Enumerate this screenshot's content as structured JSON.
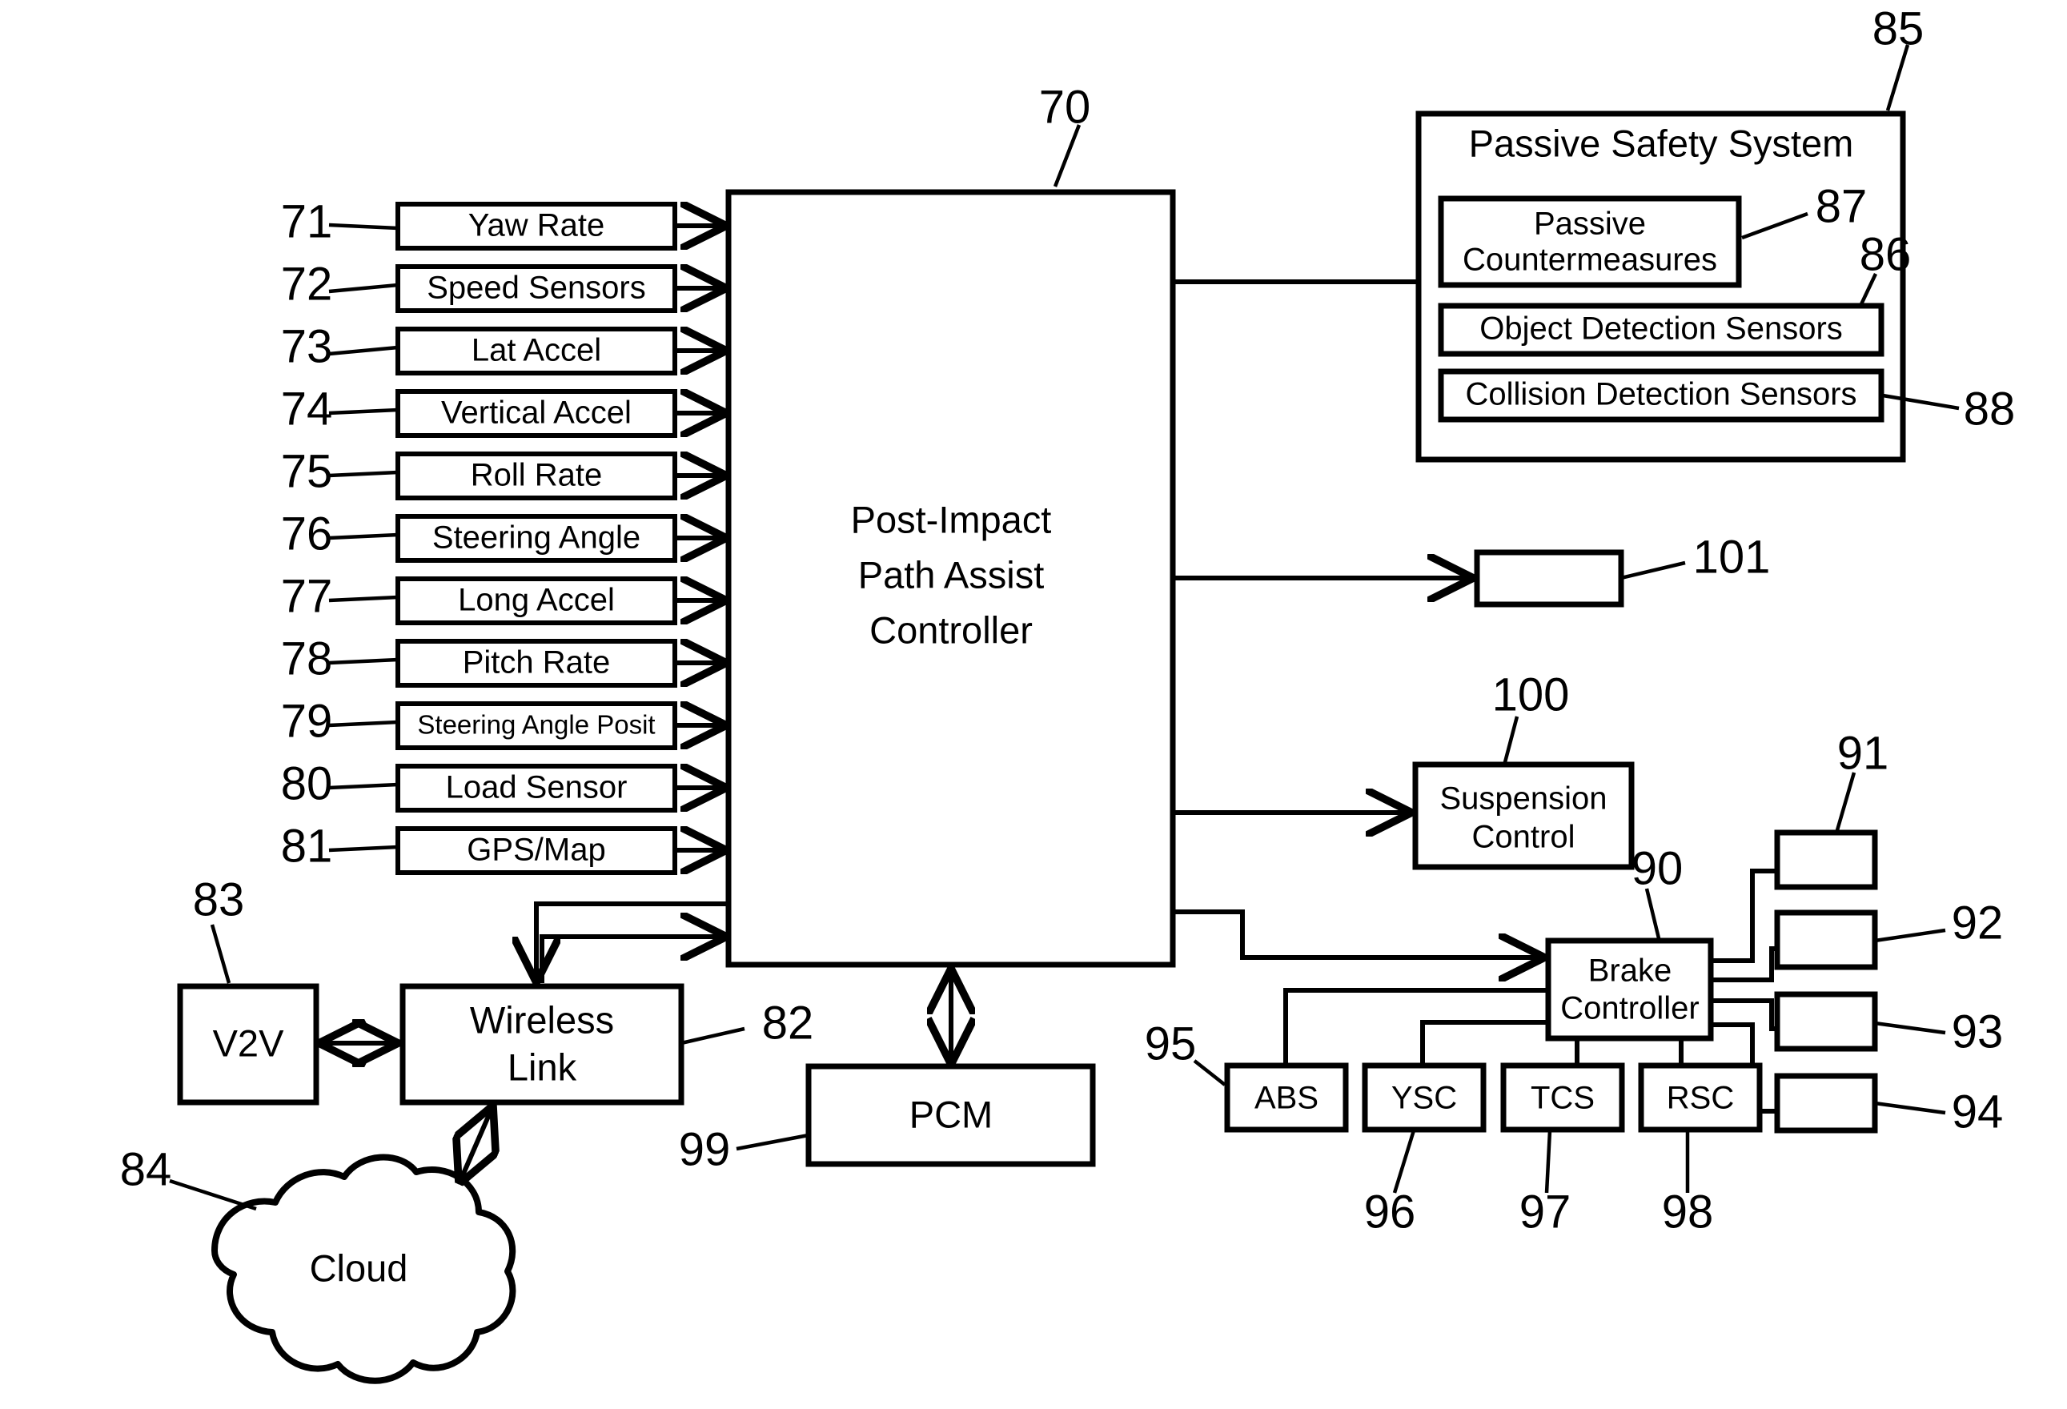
{
  "figure": {
    "title": "Post-Impact Path Assist Controller block diagram"
  },
  "controller": {
    "ref": "70",
    "line1": "Post-Impact",
    "line2": "Path Assist",
    "line3": "Controller"
  },
  "sensors": [
    {
      "ref": "71",
      "label": "Yaw Rate"
    },
    {
      "ref": "72",
      "label": "Speed Sensors"
    },
    {
      "ref": "73",
      "label": "Lat Accel"
    },
    {
      "ref": "74",
      "label": "Vertical Accel"
    },
    {
      "ref": "75",
      "label": "Roll Rate"
    },
    {
      "ref": "76",
      "label": "Steering Angle"
    },
    {
      "ref": "77",
      "label": "Long Accel"
    },
    {
      "ref": "78",
      "label": "Pitch Rate"
    },
    {
      "ref": "79",
      "label": "Steering Angle Posit"
    },
    {
      "ref": "80",
      "label": "Load Sensor"
    },
    {
      "ref": "81",
      "label": "GPS/Map"
    }
  ],
  "passive_safety": {
    "ref": "85",
    "title": "Passive Safety System",
    "children": [
      {
        "ref": "87",
        "label_line1": "Passive",
        "label_line2": "Countermeasures"
      },
      {
        "ref": "86",
        "label": "Object Detection Sensors"
      },
      {
        "ref": "88",
        "label": "Collision Detection Sensors"
      }
    ]
  },
  "unlabeled_output": {
    "ref": "101",
    "label": ""
  },
  "suspension": {
    "ref": "100",
    "line1": "Suspension",
    "line2": "Control"
  },
  "brake": {
    "ref": "90",
    "line1": "Brake",
    "line2": "Controller"
  },
  "brake_actuators": [
    {
      "ref": "91",
      "label": ""
    },
    {
      "ref": "92",
      "label": ""
    },
    {
      "ref": "93",
      "label": ""
    },
    {
      "ref": "94",
      "label": ""
    }
  ],
  "brake_subsystems": [
    {
      "ref": "95",
      "label": "ABS"
    },
    {
      "ref": "96",
      "label": "YSC"
    },
    {
      "ref": "97",
      "label": "TCS"
    },
    {
      "ref": "98",
      "label": "RSC"
    }
  ],
  "v2v": {
    "ref": "83",
    "label": "V2V"
  },
  "wireless": {
    "ref": "82",
    "line1": "Wireless",
    "line2": "Link"
  },
  "cloud": {
    "ref": "84",
    "label": "Cloud"
  },
  "pcm": {
    "ref": "99",
    "label": "PCM"
  },
  "colors": {
    "stroke": "#000000",
    "fill": "#ffffff"
  }
}
